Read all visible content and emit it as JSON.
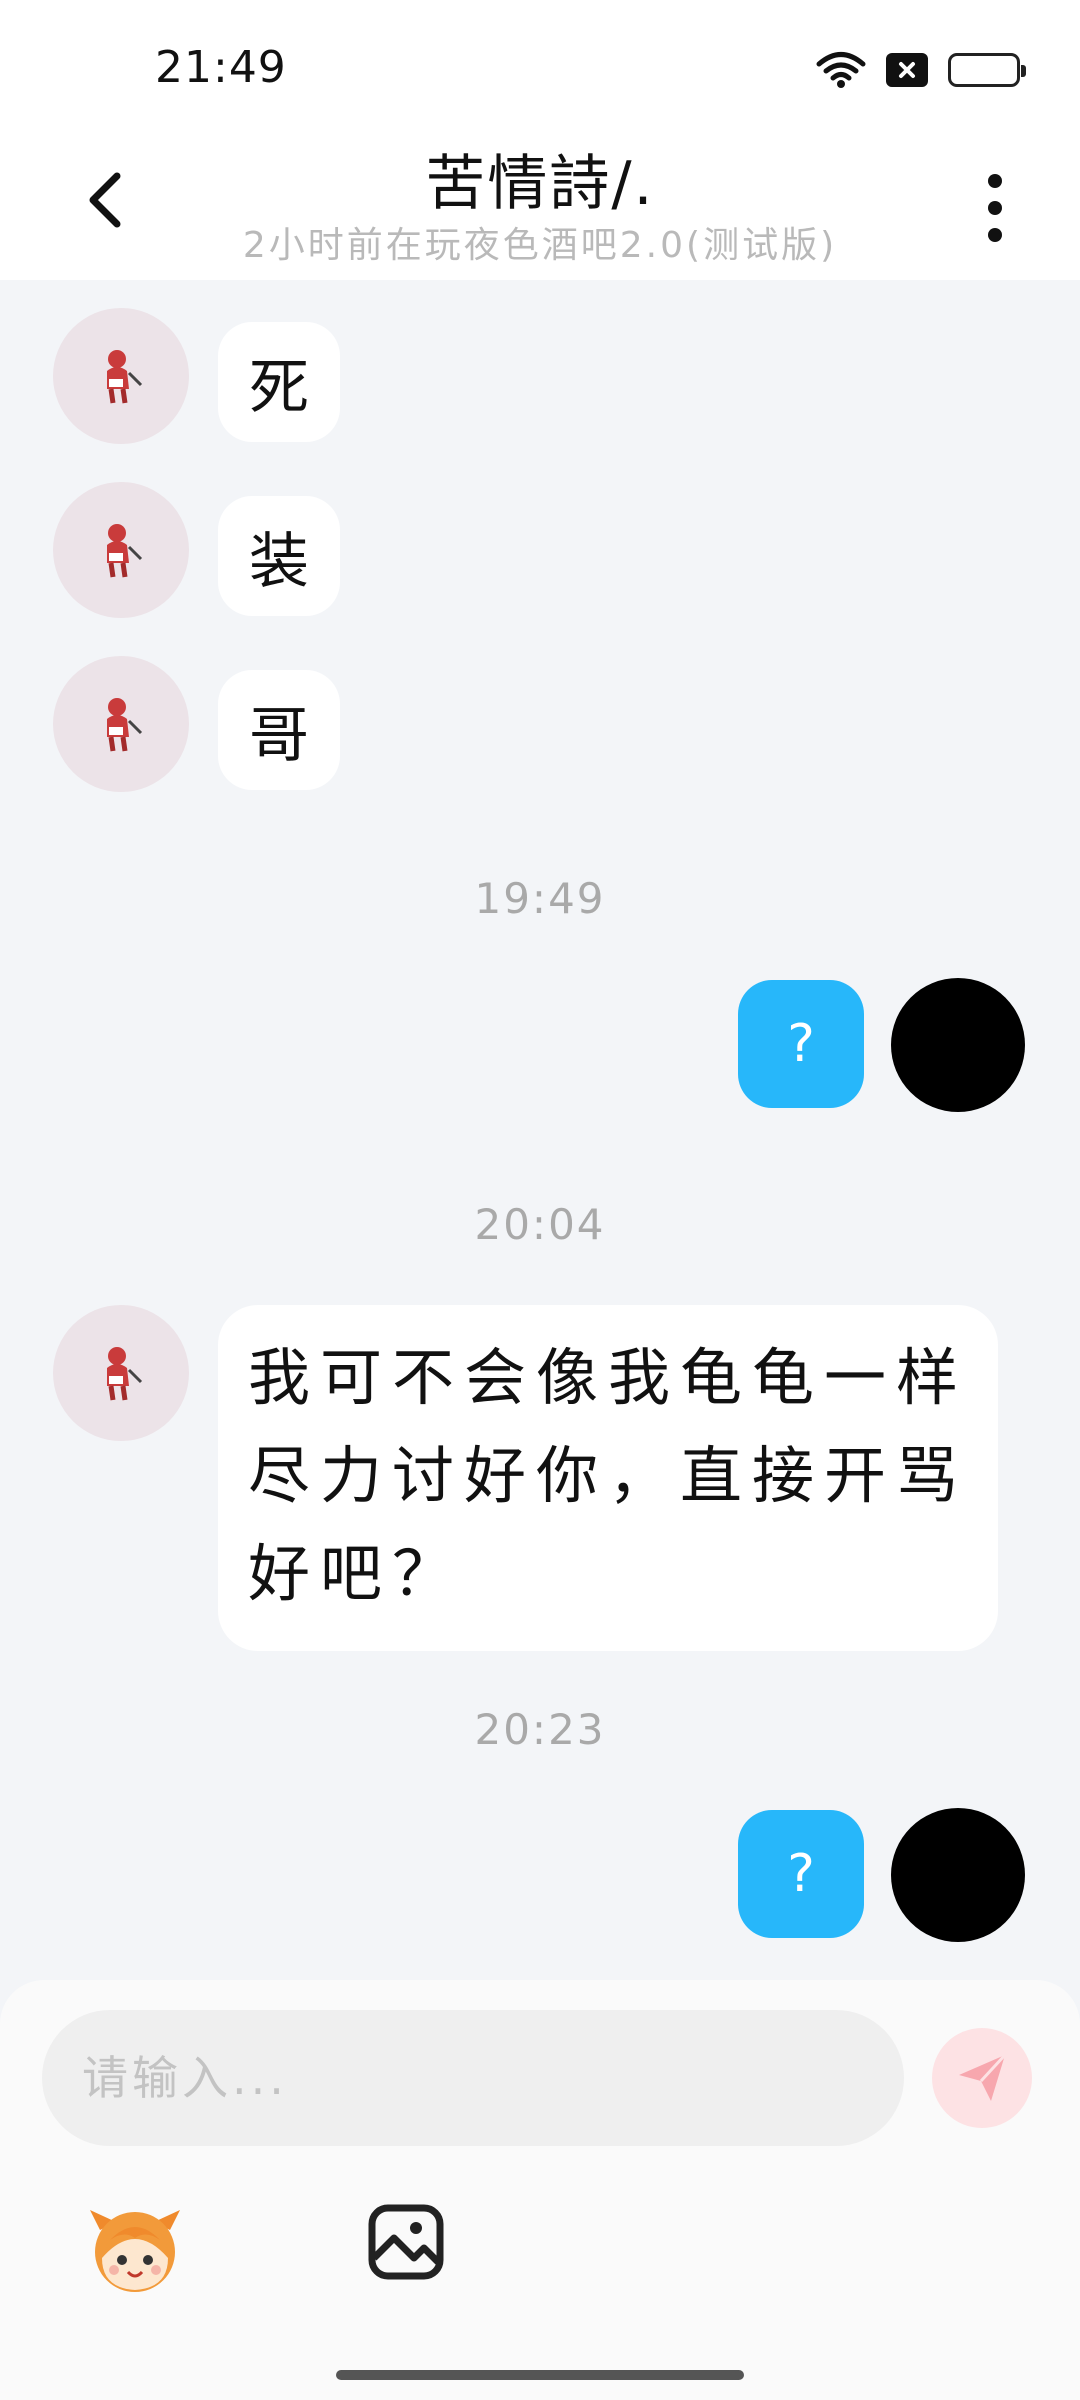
{
  "status_bar": {
    "time": "21:49",
    "icons": [
      "wifi-icon",
      "no-sim-icon",
      "battery-low-icon"
    ],
    "battery_color": "#e84a5f"
  },
  "header": {
    "title": "苦情詩/.",
    "subtitle": "2小时前在玩夜色酒吧2.0(测试版)",
    "back_icon": "chevron-left-icon",
    "more_icon": "more-vertical-icon"
  },
  "messages": [
    {
      "side": "left",
      "text": "死"
    },
    {
      "side": "left",
      "text": "装"
    },
    {
      "side": "left",
      "text": "哥"
    },
    {
      "type": "time",
      "text": "19:49"
    },
    {
      "side": "right",
      "text": "?"
    },
    {
      "type": "time",
      "text": "20:04"
    },
    {
      "side": "left",
      "lines": [
        "我可不会像我龟龟一样",
        "尽力讨好你，直接开骂",
        "好吧？"
      ]
    },
    {
      "type": "time",
      "text": "20:23"
    },
    {
      "side": "right",
      "text": "?"
    }
  ],
  "input": {
    "placeholder": "请输入..."
  },
  "colors": {
    "accent": "#27b7fa",
    "send_bg": "#fde2e4",
    "send_icon": "#f7a7ae"
  }
}
